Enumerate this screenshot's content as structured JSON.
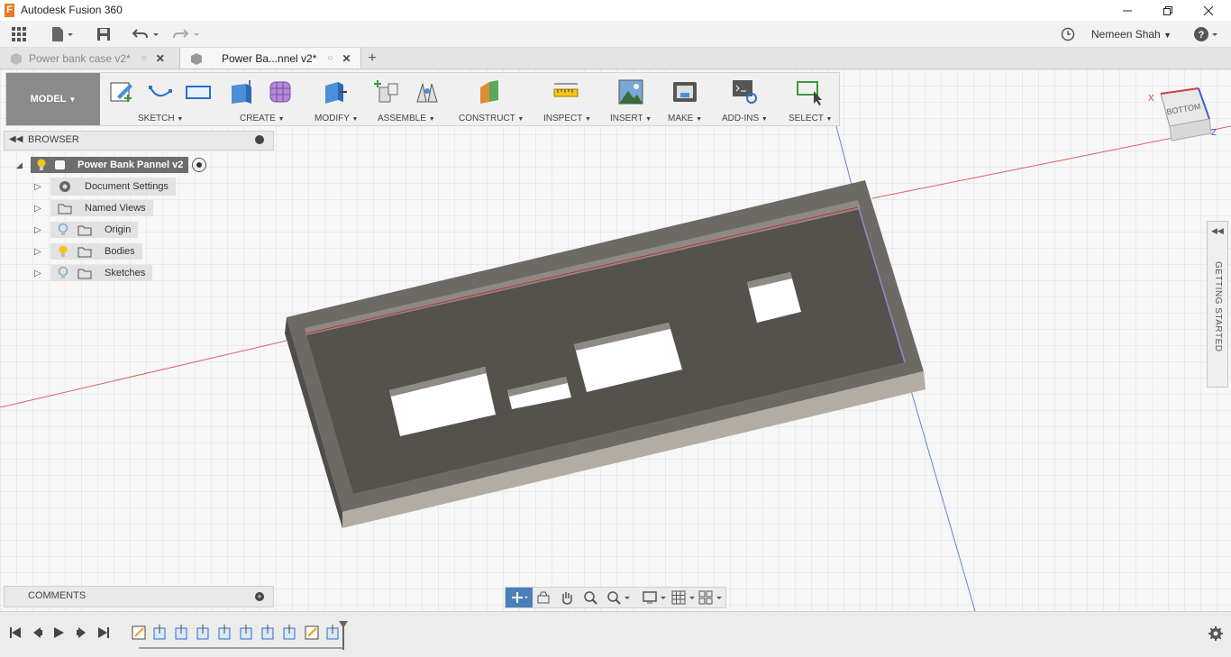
{
  "window": {
    "title": "Autodesk Fusion 360",
    "logo_letter": "F"
  },
  "user": {
    "name": "Nemeen Shah"
  },
  "tabs": [
    {
      "label": "Power bank case v2*"
    },
    {
      "label": "Power Ba...nnel v2*"
    }
  ],
  "toolbar": {
    "workspace": "MODEL",
    "groups": [
      "SKETCH",
      "CREATE",
      "MODIFY",
      "ASSEMBLE",
      "CONSTRUCT",
      "INSPECT",
      "INSERT",
      "MAKE",
      "ADD-INS",
      "SELECT"
    ]
  },
  "browser": {
    "title": "BROWSER",
    "root": "Power Bank  Pannel v2",
    "items": [
      "Document Settings",
      "Named Views",
      "Origin",
      "Bodies",
      "Sketches"
    ]
  },
  "comments": {
    "title": "COMMENTS"
  },
  "viewcube": {
    "face": "BOTTOM",
    "axis_x": "X",
    "axis_z": "Z"
  },
  "side_panel": {
    "label": "GETTING STARTED"
  },
  "colors": {
    "model_btn": "#8a8a8a",
    "accent_orange": "#f07822",
    "bulb_yellow": "#f5c518",
    "bulb_blue": "#7aa7d6"
  }
}
